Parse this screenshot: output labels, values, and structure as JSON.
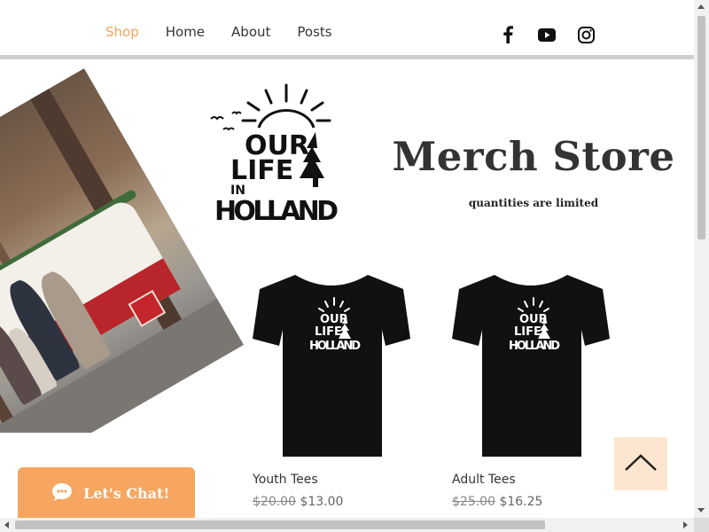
{
  "nav": {
    "items": [
      {
        "label": "Shop",
        "active": true
      },
      {
        "label": "Home",
        "active": false
      },
      {
        "label": "About",
        "active": false
      },
      {
        "label": "Posts",
        "active": false
      }
    ],
    "social_icons": [
      "facebook-icon",
      "youtube-icon",
      "instagram-icon"
    ]
  },
  "hero": {
    "logo_text": [
      "OUR",
      "LIFE",
      "IN",
      "HOLLAND"
    ],
    "title": "Merch Store",
    "subtitle": "quantities are limited"
  },
  "products": [
    {
      "name": "Youth Tees",
      "old_price": "$20.00",
      "price": "$13.00"
    },
    {
      "name": "Adult Tees",
      "old_price": "$25.00",
      "price": "$16.25"
    }
  ],
  "chat": {
    "label": "Let's Chat!"
  },
  "colors": {
    "accent": "#f2a45d",
    "chat_bg": "#f6a660",
    "back_to_top_bg": "#fde6cf"
  }
}
